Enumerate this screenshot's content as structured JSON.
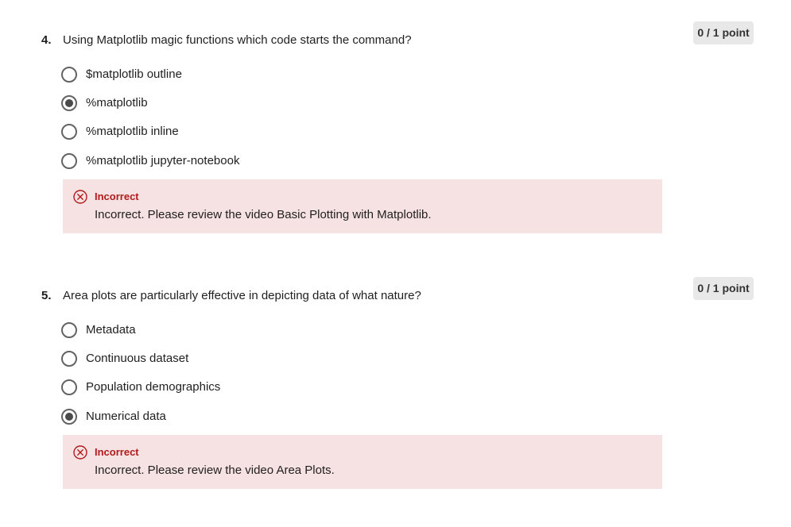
{
  "questions": [
    {
      "number": "4.",
      "text": "Using Matplotlib magic functions which code starts the command?",
      "score": "0 / 1 point",
      "options": [
        {
          "label": "$matplotlib outline",
          "selected": false
        },
        {
          "label": "%matplotlib",
          "selected": true
        },
        {
          "label": "%matplotlib inline",
          "selected": false
        },
        {
          "label": "%matplotlib jupyter-notebook",
          "selected": false
        }
      ],
      "feedback": {
        "icon": "circle-x-icon",
        "status": "Incorrect",
        "message": "Incorrect. Please review the video Basic Plotting with Matplotlib."
      }
    },
    {
      "number": "5.",
      "text": "Area plots are particularly effective in depicting data of what nature?",
      "score": "0 / 1 point",
      "options": [
        {
          "label": "Metadata",
          "selected": false
        },
        {
          "label": "Continuous dataset",
          "selected": false
        },
        {
          "label": "Population demographics",
          "selected": false
        },
        {
          "label": "Numerical data",
          "selected": true
        }
      ],
      "feedback": {
        "icon": "circle-x-icon",
        "status": "Incorrect",
        "message": "Incorrect. Please review the video Area Plots."
      }
    }
  ],
  "colors": {
    "feedback_background": "#f7e2e3",
    "incorrect_red": "#b01b1b",
    "badge_background": "#e8e8e8"
  }
}
